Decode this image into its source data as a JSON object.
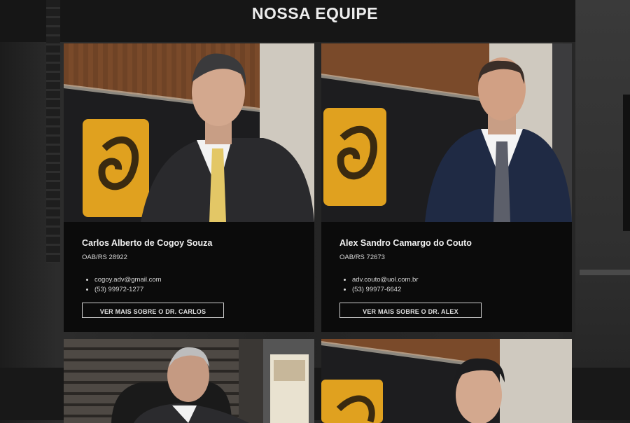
{
  "title": "NOSSA EQUIPE",
  "members": [
    {
      "name": "Carlos Alberto de Cogoy Souza",
      "oab": "OAB/RS 28922",
      "email": "cogoy.adv@gmail.com",
      "phone": "(53) 99972-1277",
      "button_label": "VER MAIS SOBRE O DR. CARLOS"
    },
    {
      "name": "Alex Sandro Camargo do Couto",
      "oab": "OAB/RS 72673",
      "email": "adv.couto@uol.com.br",
      "phone": "(53) 99977-6642",
      "button_label": "VER MAIS SOBRE O DR. ALEX"
    }
  ],
  "colors": {
    "card_background": "#0b0b0b",
    "logo_gold": "#e0a11f",
    "title_text": "#ececec"
  }
}
